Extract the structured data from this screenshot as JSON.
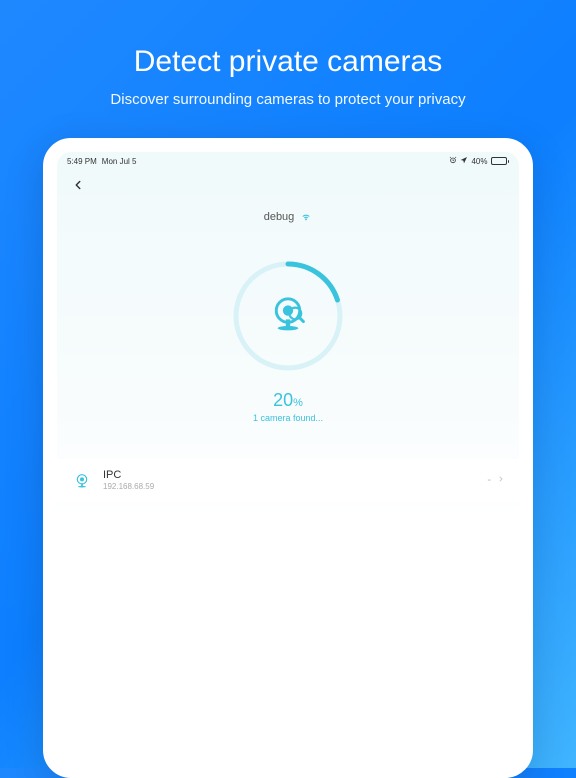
{
  "hero": {
    "title": "Detect private cameras",
    "subtitle": "Discover surrounding cameras to protect your privacy"
  },
  "statusbar": {
    "time": "5:49 PM",
    "date": "Mon Jul 5",
    "battery_pct": "40%"
  },
  "network": {
    "ssid": "debug"
  },
  "scan": {
    "progress": "20",
    "progress_unit": "%",
    "found_text": "1 camera found..."
  },
  "devices": [
    {
      "name": "IPC",
      "ip": "192.168.68.59",
      "status": "-"
    }
  ]
}
